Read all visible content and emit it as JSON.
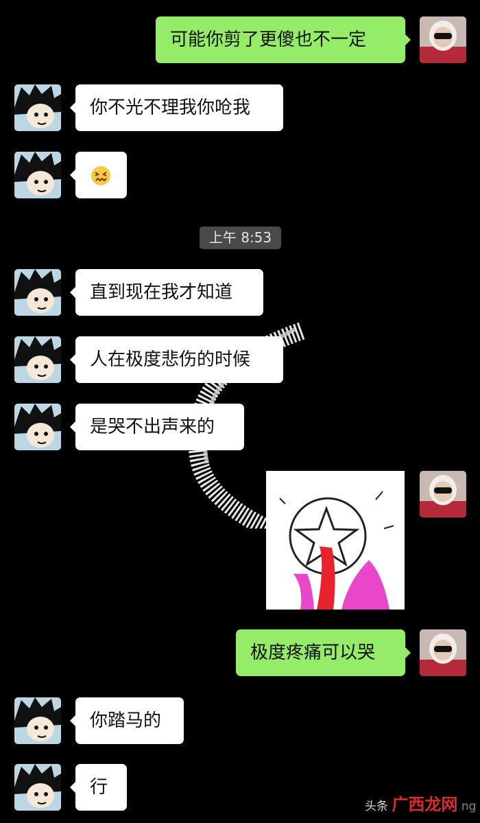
{
  "messages": [
    {
      "side": "out",
      "text": "可能你剪了更傻也不一定"
    },
    {
      "side": "in",
      "text": "你不光不理我你呛我"
    },
    {
      "side": "in",
      "emoji": "😖"
    },
    {
      "side": "in",
      "text": "直到现在我才知道"
    },
    {
      "side": "in",
      "text": "人在极度悲伤的时候"
    },
    {
      "side": "in",
      "text": "是哭不出声来的"
    },
    {
      "side": "out",
      "type": "sticker"
    },
    {
      "side": "out",
      "text": "极度疼痛可以哭"
    },
    {
      "side": "in",
      "text": "你踏马的"
    },
    {
      "side": "in",
      "text": "行"
    }
  ],
  "timestamp": "上午 8:53",
  "watermark": {
    "prefix": "头条",
    "site": "广西龙网",
    "tail": "ng"
  },
  "colors": {
    "background": "#000000",
    "incoming_bubble": "#ffffff",
    "outgoing_bubble": "#95ec69",
    "timestamp_bg": "#4a4a4a"
  },
  "icons": {
    "contact_avatar": "cartoon-boy-avatar-icon",
    "self_avatar": "girl-photo-avatar-icon",
    "sticker": "star-nosebleed-sticker"
  }
}
